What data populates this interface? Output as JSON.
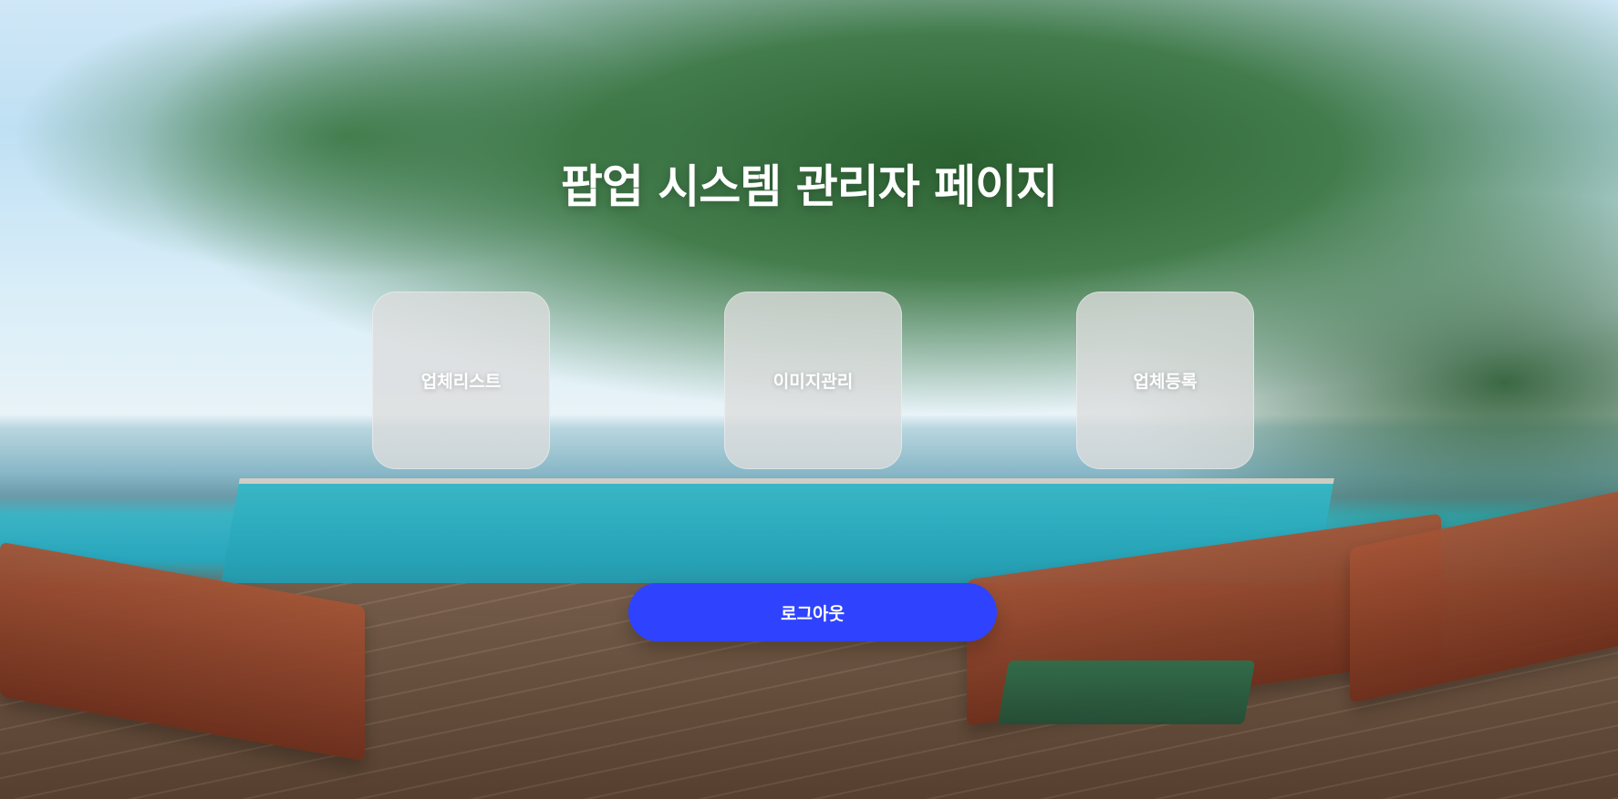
{
  "header": {
    "title": "팝업 시스템 관리자 페이지"
  },
  "menu": {
    "tiles": [
      {
        "label": "업체리스트"
      },
      {
        "label": "이미지관리"
      },
      {
        "label": "업체등록"
      }
    ]
  },
  "actions": {
    "logout_label": "로그아웃"
  },
  "colors": {
    "primary_button": "#2f43ff",
    "tile_background": "rgba(220,220,220,0.78)",
    "text": "#ffffff"
  }
}
